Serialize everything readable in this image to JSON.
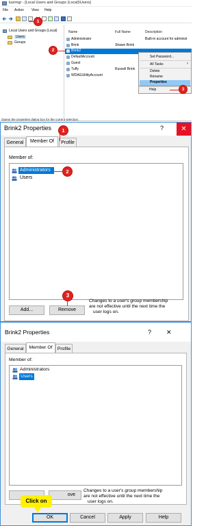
{
  "mmc": {
    "title": "lusrmgr - [Local Users and Groups (Local)\\Users]",
    "menu": [
      "File",
      "Action",
      "View",
      "Help"
    ],
    "tree": {
      "root": "Local Users and Groups (Local)",
      "items": [
        "Users",
        "Groups"
      ]
    },
    "columns": [
      "Name",
      "Full Name",
      "Description"
    ],
    "rows": [
      {
        "name": "Administrator",
        "full_name": "",
        "description": "Built-in account for administ"
      },
      {
        "name": "Brink",
        "full_name": "Shawn Brink",
        "description": ""
      },
      {
        "name": "Brink2",
        "full_name": "",
        "description": ""
      },
      {
        "name": "DefaultAccount",
        "full_name": "",
        "description": ""
      },
      {
        "name": "Guest",
        "full_name": "",
        "description": ""
      },
      {
        "name": "Tuffy",
        "full_name": "Russell Brink",
        "description": ""
      },
      {
        "name": "WDAGUtilityAccount",
        "full_name": "",
        "description": ""
      }
    ],
    "context_menu": [
      "Set Password...",
      "All Tasks",
      "Delete",
      "Rename",
      "Properties",
      "Help"
    ],
    "submenu_arrow": "›",
    "status": "Opens the properties dialog box for the current selection."
  },
  "dialog1": {
    "title": "Brink2 Properties",
    "help_glyph": "?",
    "close_glyph": "✕",
    "tabs": [
      "General",
      "Member Of",
      "Profile"
    ],
    "member_of_label": "Member of:",
    "members": [
      "Administrators",
      "Users"
    ],
    "add_label": "Add...",
    "remove_label": "Remove",
    "note": [
      "Changes to a user's group membership",
      "are not effective until the next time the",
      "user logs on."
    ]
  },
  "dialog2": {
    "title": "Brink2 Properties",
    "help_glyph": "?",
    "close_glyph": "✕",
    "tabs": [
      "General",
      "Member Of",
      "Profile"
    ],
    "member_of_label": "Member of:",
    "members": [
      "Administrators",
      "Users"
    ],
    "remove_partial": "ove",
    "note": [
      "Changes to a user's group membership",
      "are not effective until the next time the",
      "user logs on."
    ],
    "buttons": {
      "ok": "OK",
      "cancel": "Cancel",
      "apply": "Apply",
      "help": "Help"
    }
  },
  "annotations": {
    "step1": "1",
    "step2": "2",
    "step3": "3",
    "click_on": "Click on"
  },
  "colors": {
    "accent": "#e0231f",
    "selection": "#0078d7",
    "callout": "#fff200"
  }
}
